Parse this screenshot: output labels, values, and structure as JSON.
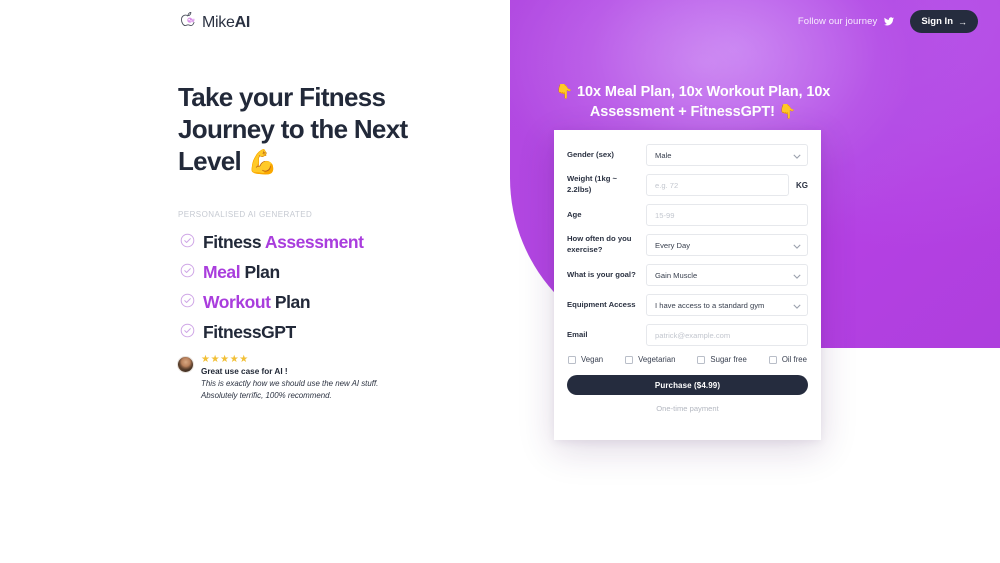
{
  "brand": {
    "logo_icon": "apple-logo-icon",
    "name_light": "Mike",
    "name_bold": "AI"
  },
  "hero": {
    "headline_line1": "Take your Fitness",
    "headline_line2": "Journey to the Next",
    "headline_line3": "Level",
    "headline_emoji": "💪",
    "kicker": "PERSONALISED AI GENERATED",
    "features": [
      {
        "icon": "check-circle-icon",
        "part1": "Fitness ",
        "part1_accent": false,
        "part2": "Assessment",
        "part2_accent": true
      },
      {
        "icon": "check-circle-icon",
        "part1": "Meal",
        "part1_accent": true,
        "part2": " Plan",
        "part2_accent": false
      },
      {
        "icon": "check-circle-icon",
        "part1": "Workout",
        "part1_accent": true,
        "part2": " Plan",
        "part2_accent": false
      },
      {
        "icon": "check-circle-icon",
        "part1": "FitnessGPT",
        "part1_accent": false,
        "part2": "",
        "part2_accent": false
      }
    ]
  },
  "testimonial": {
    "avatar": "user-avatar",
    "stars": "★★★★★",
    "rating": 5,
    "title": "Great use case for AI !",
    "quote_line1": "This is exactly how we should use the new AI stuff.",
    "quote_line2": "Absolutely terrific, 100% recommend."
  },
  "topbar": {
    "follow_text": "Follow our journey",
    "twitter_icon": "twitter-bird-icon",
    "signin_label": "Sign In",
    "signin_arrow": "→"
  },
  "promo": {
    "emoji_left": "👇",
    "line1": "10x Meal Plan, 10x Workout Plan, 10x",
    "line2": "Assessment + FitnessGPT!",
    "emoji_right": "👇"
  },
  "form": {
    "fields": [
      {
        "label": "Gender (sex)",
        "type": "select",
        "value": "Male",
        "name": "gender"
      },
      {
        "label": "Weight (1kg ~ 2.2lbs)",
        "type": "text",
        "value": "",
        "placeholder": "e.g. 72",
        "unit": "KG",
        "name": "weight"
      },
      {
        "label": "Age",
        "type": "text",
        "value": "",
        "placeholder": "15-99",
        "name": "age"
      },
      {
        "label": "How often do you exercise?",
        "type": "select",
        "value": "Every Day",
        "name": "frequency"
      },
      {
        "label": "What is your goal?",
        "type": "select",
        "value": "Gain Muscle",
        "name": "goal"
      },
      {
        "label": "Equipment Access",
        "type": "select",
        "value": "I have access to a standard gym",
        "name": "equipment"
      },
      {
        "label": "Email",
        "type": "text",
        "value": "",
        "placeholder": "patrick@example.com",
        "name": "email"
      }
    ],
    "diet_options": [
      {
        "label": "Vegan",
        "checked": false
      },
      {
        "label": "Vegetarian",
        "checked": false
      },
      {
        "label": "Sugar free",
        "checked": false
      },
      {
        "label": "Oil free",
        "checked": false
      }
    ],
    "purchase_label": "Purchase ($4.99)",
    "price": "$4.99",
    "footnote": "One-time payment"
  },
  "colors": {
    "accent_purple": "#a93ddd",
    "panel_purple": "#b444e3",
    "dark_navy": "#252c3e",
    "star_gold": "#f2c037",
    "muted_gray": "#c6cad2"
  }
}
